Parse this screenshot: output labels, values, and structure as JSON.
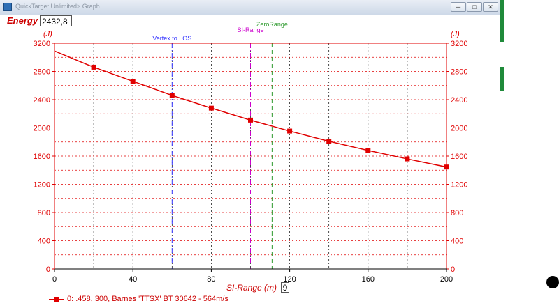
{
  "window": {
    "title": "QuickTarget Unlimited> Graph",
    "buttons": [
      "minimize",
      "maximize",
      "close"
    ]
  },
  "readout": {
    "label": "Energy",
    "value": "2432,8"
  },
  "xaxis_input": {
    "label": "SI-Range (m)",
    "value": "9"
  },
  "chart_data": {
    "type": "line",
    "xlabel": "SI-Range (m)",
    "ylabel_left": "(J)",
    "ylabel_right": "(J)",
    "xlim": [
      0,
      200
    ],
    "ylim": [
      0,
      3200
    ],
    "xticks": [
      0,
      40,
      80,
      120,
      160,
      200
    ],
    "yticks": [
      0,
      400,
      800,
      1200,
      1600,
      2000,
      2400,
      2800,
      3200
    ],
    "grid": true,
    "legend_position": "bottom-left",
    "series": [
      {
        "name": "0: .458, 300, Barnes 'TTSX' BT 30642 - 564m/s",
        "color": "#e00000",
        "x": [
          0,
          20,
          40,
          60,
          80,
          100,
          120,
          140,
          160,
          180,
          200
        ],
        "y": [
          3090,
          2860,
          2660,
          2460,
          2280,
          2110,
          1955,
          1810,
          1680,
          1560,
          1445
        ],
        "markers_at": [
          20,
          40,
          60,
          80,
          100,
          120,
          140,
          160,
          180,
          200
        ]
      }
    ],
    "annotations": [
      {
        "label": "Vertex to LOS",
        "x": 60,
        "color": "#3333ff",
        "style": "dash-dot"
      },
      {
        "label": "SI-Range",
        "x": 100,
        "color": "#cc00cc",
        "style": "dash-dot"
      },
      {
        "label": "ZeroRange",
        "x": 111,
        "color": "#2d9a2d",
        "style": "dash"
      }
    ]
  },
  "icons": {
    "app": "app-icon",
    "minimize": "minimize-icon",
    "maximize": "maximize-icon",
    "close": "close-icon"
  }
}
